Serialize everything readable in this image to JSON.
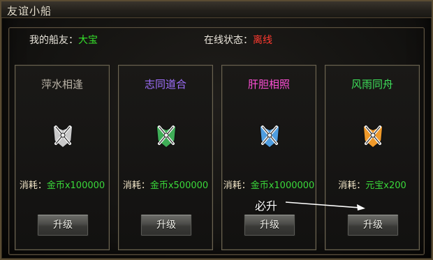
{
  "window": {
    "title": "友谊小船"
  },
  "info": {
    "friend_label": "我的船友：",
    "friend_name": "大宝",
    "status_label": "在线状态：",
    "status_value": "离线"
  },
  "cards": [
    {
      "title": "萍水相逢",
      "title_color": "#b9b2a6",
      "emblem_color": "#c9c9c9",
      "cost_label": "消耗：",
      "cost_value": "金币x100000",
      "button": "升级"
    },
    {
      "title": "志同道合",
      "title_color": "#a070ff",
      "emblem_color": "#3fae57",
      "cost_label": "消耗：",
      "cost_value": "金币x500000",
      "button": "升级"
    },
    {
      "title": "肝胆相照",
      "title_color": "#ff4fd6",
      "emblem_color": "#4f9ee0",
      "cost_label": "消耗：",
      "cost_value": "金币x1000000",
      "button": "升级"
    },
    {
      "title": "风雨同舟",
      "title_color": "#3ee05a",
      "emblem_color": "#f09a2a",
      "cost_label": "消耗：",
      "cost_value": "元宝x200",
      "button": "升级"
    }
  ],
  "annotation": {
    "text": "必升"
  }
}
